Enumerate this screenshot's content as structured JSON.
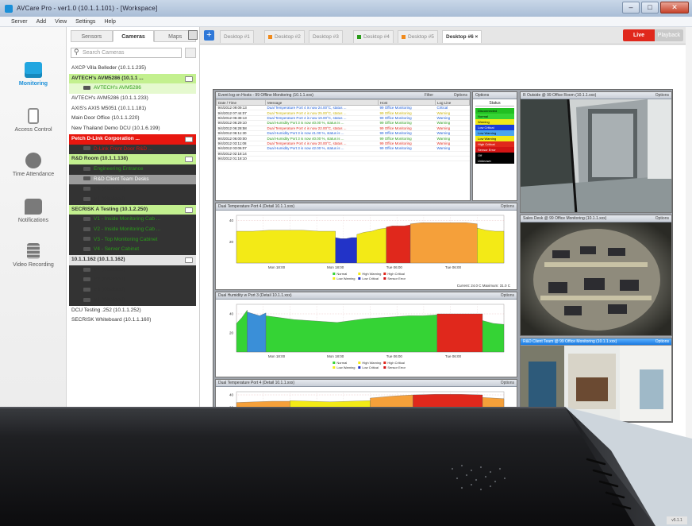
{
  "window": {
    "title": "AVCare Pro - ver1.0 (10.1.1.101) - [Workspace]",
    "buttons": [
      "–",
      "□",
      "✕"
    ]
  },
  "menu": [
    "Server",
    "Add",
    "View",
    "Settings",
    "Help"
  ],
  "nav": [
    {
      "label": "Monitoring",
      "icon": "monitor-icon"
    },
    {
      "label": "Access Control",
      "icon": "door-icon"
    },
    {
      "label": "Time Attendance",
      "icon": "clock-icon"
    },
    {
      "label": "Notifications",
      "icon": "chat-icon"
    },
    {
      "label": "Video Recording",
      "icon": "server-icon"
    }
  ],
  "tree_tabs": [
    "Sensors",
    "Cameras",
    "Maps"
  ],
  "search": {
    "placeholder": "Search Cameras"
  },
  "tree": [
    {
      "text": "AXCP Villa Belleder (10.1.1.235)",
      "style": "",
      "lvl": 1
    },
    {
      "text": "AVTECH's AVM5286 (10.1.1 ...",
      "style": "green",
      "lvl": 1
    },
    {
      "text": "AVTECH's AVM5286",
      "style": "greenline",
      "lvl": 2
    },
    {
      "text": "AVTECH's AVM5286 (10.1.1.233)",
      "style": "",
      "lvl": 1
    },
    {
      "text": "AXIS's AXIS M5051 (10.1.1.181)",
      "style": "",
      "lvl": 1
    },
    {
      "text": "Main Door Office (10.1.1.220)",
      "style": "",
      "lvl": 1
    },
    {
      "text": "New Thailand Demo DCU (10.1.6.199)",
      "style": "",
      "lvl": 1
    },
    {
      "text": "Petch D-Link Corporation ...",
      "style": "red",
      "lvl": 1
    },
    {
      "text": "D-Link Front Door R&D ...",
      "style": "redtxt",
      "lvl": 2
    },
    {
      "text": "R&D Room (10.1.1.138)",
      "style": "green",
      "lvl": 1
    },
    {
      "text": "Engineering Entrance",
      "style": "greentxt",
      "lvl": 2
    },
    {
      "text": "R&D Client Team Desks",
      "style": "sel",
      "lvl": 2
    },
    {
      "text": "V3 (Disabled)",
      "style": "",
      "lvl": 2
    },
    {
      "text": "V4 (Disabled)",
      "style": "",
      "lvl": 2
    },
    {
      "text": "SECRISK A Testing (10.1.2.250)",
      "style": "green",
      "lvl": 1
    },
    {
      "text": "V1 - Inside Monitoring Cab ...",
      "style": "greentxt",
      "lvl": 2
    },
    {
      "text": "V2 - Inside Monitoring Cab ...",
      "style": "greentxt",
      "lvl": 2
    },
    {
      "text": "V3 - Top Monitoring Cabinet",
      "style": "greentxt",
      "lvl": 2
    },
    {
      "text": "V4 - Server Cabinet",
      "style": "greentxt",
      "lvl": 2
    },
    {
      "text": "10.1.1.162 (10.1.1.162)",
      "style": "grey",
      "lvl": 1
    },
    {
      "text": "V1 (Disabled)",
      "style": "",
      "lvl": 2
    },
    {
      "text": "V2 (Disabled)",
      "style": "",
      "lvl": 2
    },
    {
      "text": "V3 (Disabled)",
      "style": "",
      "lvl": 2
    },
    {
      "text": "V4 (Disabled)",
      "style": "",
      "lvl": 2
    },
    {
      "text": "DCU Testing .252 (10.1.1.252)",
      "style": "",
      "lvl": 1
    },
    {
      "text": "SECRISK Whiteboard (10.1.1.160)",
      "style": "",
      "lvl": 1
    }
  ],
  "desktop_tabs": [
    {
      "label": "Desktop #1",
      "color": ""
    },
    {
      "label": "Desktop #2",
      "color": "#f08a1c"
    },
    {
      "label": "Desktop #3",
      "color": ""
    },
    {
      "label": "Desktop #4",
      "color": "#2a9c1a"
    },
    {
      "label": "Desktop #5",
      "color": "#f08a1c"
    },
    {
      "label": "Desktop #6",
      "color": "",
      "active": true
    }
  ],
  "live_label": "Live",
  "playback_label": "Playback",
  "eventlog": {
    "title": "Event log on Hosts - 99 Offline Monitoring (10.1.1.xxx)",
    "filter": "Filter",
    "options": "Options",
    "columns": [
      "Date / Time",
      "Message",
      "Host",
      "Log Line"
    ],
    "rows": [
      {
        "dt": "9/4/2012 09:09:13",
        "msg": "Dual Temperature Port 4 is now 24.00°C, status ...",
        "host": "99 Office Monitoring",
        "lvl": "Critical",
        "color": "#1a5bd8"
      },
      {
        "dt": "9/4/2012 07:44:07",
        "msg": "Dual Temperature Port 4 is now 25.00°C, status ...",
        "host": "99 Office Monitoring",
        "lvl": "Warning",
        "color": "#c9b200"
      },
      {
        "dt": "9/4/2012 06:38:13",
        "msg": "Dual Temperature Port 4 is now 19.00°C, status ...",
        "host": "99 Office Monitoring",
        "lvl": "Warning",
        "color": "#1a5bd8"
      },
      {
        "dt": "9/4/2012 06:29:10",
        "msg": "Dual Humidity Port 3 is now 40.00 %, status is ...",
        "host": "99 Office Monitoring",
        "lvl": "Warning",
        "color": "#2a9c1a"
      },
      {
        "dt": "9/4/2012 06:28:58",
        "msg": "Dual Temperature Port 4 is now 22.00°C, status ...",
        "host": "99 Office Monitoring",
        "lvl": "Warning",
        "color": "#e0281c"
      },
      {
        "dt": "9/4/2012 06:11:30",
        "msg": "Dual Humidity Port 3 is now 41.00 %, status is ...",
        "host": "99 Office Monitoring",
        "lvl": "Warning",
        "color": "#1a5bd8"
      },
      {
        "dt": "9/4/2012 06:00:00",
        "msg": "Dual Humidity Port 3 is now 40.00 %, status is ...",
        "host": "99 Office Monitoring",
        "lvl": "Warning",
        "color": "#2a9c1a"
      },
      {
        "dt": "9/4/2012 03:11:08",
        "msg": "Dual Temperature Port 4 is now 20.00°C, status ...",
        "host": "99 Office Monitoring",
        "lvl": "Warning",
        "color": "#e0281c"
      },
      {
        "dt": "9/4/2012 03:06:07",
        "msg": "Dual Humidity Port 3 is now 42.00 %, status is ...",
        "host": "99 Office Monitoring",
        "lvl": "Warning",
        "color": "#1a5bd8"
      },
      {
        "dt": "9/4/2012 02:18:14",
        "msg": "",
        "host": "",
        "lvl": "",
        "color": "#c9b200"
      },
      {
        "dt": "9/4/2012 01:18:10",
        "msg": "",
        "host": "",
        "lvl": "",
        "color": "#c9b200"
      }
    ]
  },
  "status_legend": {
    "title": "Options",
    "header": "Status",
    "items": [
      {
        "label": "Disconnected",
        "color": "#21c021"
      },
      {
        "label": "Normal",
        "color": "#35d335"
      },
      {
        "label": "Warning",
        "color": "#f1ea1a"
      },
      {
        "label": "Low Critical",
        "color": "#1a3fd8"
      },
      {
        "label": "Low Warning",
        "color": "#4aa5f0"
      },
      {
        "label": "Low Warning",
        "color": "#f1ea1a"
      },
      {
        "label": "High Critical",
        "color": "#e0281c"
      },
      {
        "label": "Sensor Error",
        "color": "#d11414"
      },
      {
        "label": "Off",
        "color": "#000000"
      },
      {
        "label": "Unknown",
        "color": "#000000"
      }
    ]
  },
  "cameras": [
    {
      "title": "R Outside @ 99 Office Room (10.1.1.xxx)",
      "options": "Options"
    },
    {
      "title": "Sales Desk @ 99 Office Monitoring (10.1.1.xxx)",
      "options": "Options"
    },
    {
      "title": "R&D Client Team @ 99 Office Monitoring (10.1.1.xxx)",
      "options": "Options"
    }
  ],
  "charts": [
    {
      "title": "Dual Temperature Port 4 (Detail 10.1.1.xxx)",
      "options": "Options",
      "footer": "Current: 24.0 C   Maximum: 31.0 C"
    },
    {
      "title": "Dual Humidity w Port 3 (Detail 10.1.1.xxx)",
      "options": "Options",
      "footer": ""
    },
    {
      "title": "Dual Temperature Port 4 (Detail 10.1.1.xxx)",
      "options": "Options",
      "footer": ""
    }
  ],
  "chart_data": [
    {
      "type": "area",
      "title": "Dual Temperature Port 4 (Detail 10.1.1.xxx)",
      "ylim": [
        0,
        45
      ],
      "yticks": [
        20,
        40
      ],
      "xticks": [
        "Mon 18:00",
        "Mon 18:00",
        "Tue 06:00",
        "Tue 06:00"
      ],
      "legend": [
        "Normal",
        "High Warning",
        "High Critical",
        "Low Warning",
        "Low Critical",
        "Sensor Error"
      ],
      "segments": [
        {
          "from": 0,
          "to": 0.37,
          "color": "#f3ea16",
          "values": [
            30,
            30,
            31,
            31,
            31,
            30,
            30
          ]
        },
        {
          "from": 0.37,
          "to": 0.45,
          "color": "#2233c8",
          "values": [
            24,
            23,
            23,
            24,
            24
          ]
        },
        {
          "from": 0.45,
          "to": 0.56,
          "color": "#f3ea16",
          "values": [
            27,
            29,
            30,
            32,
            33
          ]
        },
        {
          "from": 0.56,
          "to": 0.65,
          "color": "#e0281c",
          "values": [
            34,
            35,
            35,
            35,
            36
          ]
        },
        {
          "from": 0.65,
          "to": 0.9,
          "color": "#f5a03a",
          "values": [
            37,
            38,
            38,
            38,
            38,
            38,
            37
          ]
        },
        {
          "from": 0.9,
          "to": 1,
          "color": "#f3ea16",
          "values": [
            33,
            31,
            30,
            30
          ]
        }
      ]
    },
    {
      "type": "area",
      "title": "Dual Humidity w Port 3 (Detail 10.1.1.xxx)",
      "ylim": [
        0,
        50
      ],
      "yticks": [
        20,
        40
      ],
      "xticks": [
        "Mon 18:00",
        "Mon 18:00",
        "Tue 06:00",
        "Tue 06:00"
      ],
      "legend": [
        "Normal",
        "High Warning",
        "High Critical",
        "Low Warning",
        "Low Critical",
        "Sensor Error"
      ],
      "segments": [
        {
          "from": 0,
          "to": 0.04,
          "color": "#35d335",
          "values": [
            30,
            36,
            44
          ]
        },
        {
          "from": 0.04,
          "to": 0.11,
          "color": "#3a8fd8",
          "values": [
            42,
            40,
            38,
            41
          ]
        },
        {
          "from": 0.11,
          "to": 0.75,
          "color": "#35d335",
          "values": [
            38,
            36,
            34,
            33,
            32,
            31,
            33,
            35,
            36,
            37,
            38,
            38,
            39
          ]
        },
        {
          "from": 0.75,
          "to": 0.92,
          "color": "#e0281c",
          "values": [
            40,
            40,
            40,
            40,
            40
          ]
        },
        {
          "from": 0.92,
          "to": 1,
          "color": "#35d335",
          "values": [
            33,
            30,
            29
          ]
        }
      ]
    },
    {
      "type": "area",
      "title": "Dual Temperature Port 4 (Detail 10.1.1.xxx)",
      "ylim": [
        0,
        45
      ],
      "yticks": [
        20,
        40
      ],
      "xticks": [],
      "legend": [],
      "segments": [
        {
          "from": 0,
          "to": 0.2,
          "color": "#f5a03a",
          "values": [
            28,
            29,
            30,
            30
          ]
        },
        {
          "from": 0.2,
          "to": 0.5,
          "color": "#f3ea16",
          "values": [
            31,
            30,
            29,
            30,
            31
          ]
        },
        {
          "from": 0.5,
          "to": 0.66,
          "color": "#f5a03a",
          "values": [
            35,
            38,
            40
          ]
        },
        {
          "from": 0.66,
          "to": 0.92,
          "color": "#e0281c",
          "values": [
            40,
            41,
            41,
            40
          ]
        },
        {
          "from": 0.92,
          "to": 1,
          "color": "#f5a03a",
          "values": [
            36,
            34
          ]
        }
      ]
    }
  ],
  "version": "v5.1.1"
}
